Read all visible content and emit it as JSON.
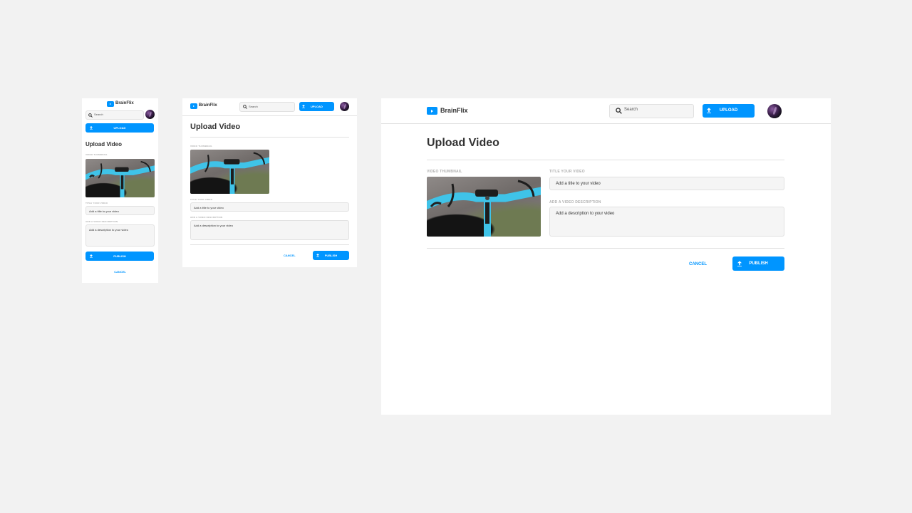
{
  "brand": {
    "name": "BrainFlix"
  },
  "search": {
    "placeholder": "Search"
  },
  "header": {
    "upload_label": "UPLOAD"
  },
  "page": {
    "title": "Upload Video"
  },
  "form": {
    "thumbnail_label": "VIDEO THUMBNAIL",
    "title_label": "TITLE YOUR VIDEO",
    "title_placeholder": "Add a title to your video",
    "description_label": "ADD A VIDEO DESCRIPTION",
    "description_placeholder": "Add a description to your video"
  },
  "actions": {
    "publish_label": "PUBLISH",
    "cancel_label": "CANCEL"
  },
  "icons": {
    "logo": "play-icon",
    "search": "search-icon",
    "upload": "upload-icon",
    "publish": "publish-icon",
    "avatar": "user-avatar"
  },
  "colors": {
    "accent": "#0095ff",
    "background": "#f2f2f2",
    "field_bg": "#f5f5f5",
    "label": "#afafaf",
    "text": "#323232"
  }
}
